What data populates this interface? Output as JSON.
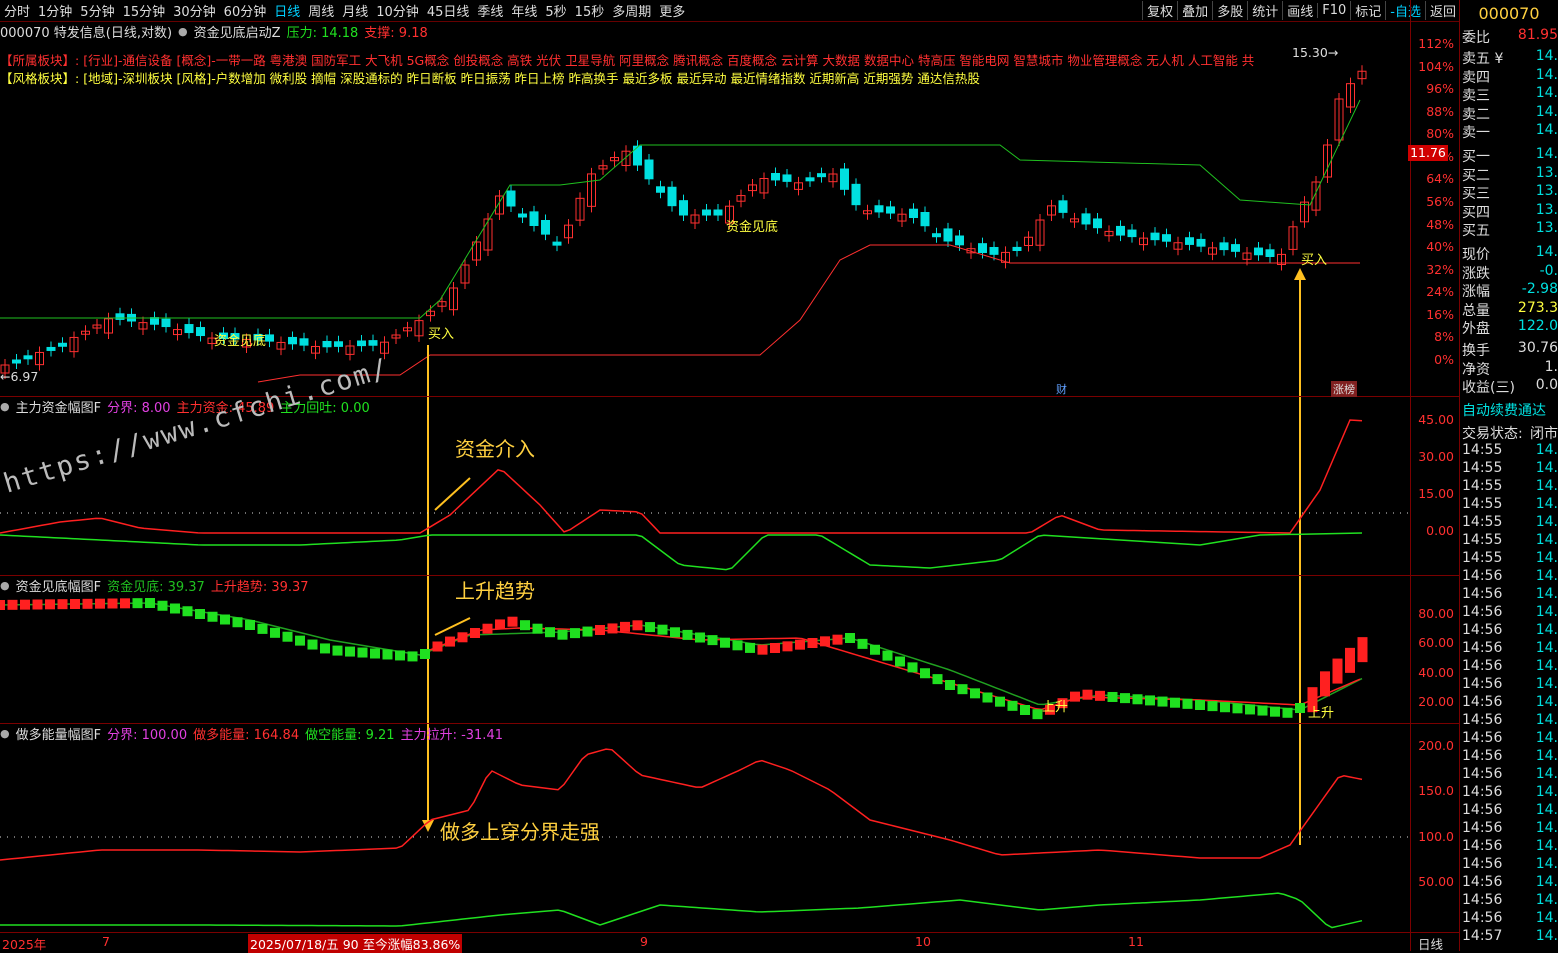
{
  "toolbar": {
    "periods": [
      "分时",
      "1分钟",
      "5分钟",
      "15分钟",
      "30分钟",
      "60分钟",
      "日线",
      "周线",
      "月线",
      "10分钟",
      "45日线",
      "季线",
      "年线",
      "5秒",
      "15秒",
      "多周期",
      "更多"
    ],
    "active": "日线",
    "tools": [
      "复权",
      "叠加",
      "多股",
      "统计",
      "画线",
      "F10",
      "标记",
      "-自选",
      "返回"
    ]
  },
  "main": {
    "title": "000070 特发信息(日线,对数)",
    "indicator": "资金见底启动Z",
    "pressure": "压力: 14.18",
    "support": "支撑: 9.18",
    "industry_label": "【所属板块】:",
    "industry_text": "[行业]-通信设备 [概念]-一带一路 粤港澳 国防军工 大飞机 5G概念 创投概念 高铁 光伏 卫星导航 阿里概念 腾讯概念 百度概念 云计算 大数据 数据中心 特高压 智能电网 智慧城市 物业管理概念 无人机 人工智能 共",
    "style_label": "【风格板块】:",
    "style_text": "[地域]-深圳板块 [风格]-户数增加 微利股 摘帽 深股通标的 昨日断板 昨日振荡 昨日上榜 昨高换手 最近多板 最近异动 最近情绪指数 近期新高 近期强势 通达信热股",
    "low_label": "6.97",
    "high_label": "15.30",
    "price_tag": "11.76",
    "buy_label_1": "买入",
    "buy_label_2": "买入",
    "zjjd_1": "资金见底",
    "zjjd_2": "资金见底",
    "cai": "财",
    "zhangbang": "涨榜",
    "axis": [
      "112%",
      "104%",
      "96%",
      "88%",
      "80%",
      "72%",
      "64%",
      "56%",
      "48%",
      "40%",
      "32%",
      "24%",
      "16%",
      "8%",
      "0%"
    ]
  },
  "panel1": {
    "name": "主力资金幅图F",
    "divide": "分界: 8.00",
    "main_fund": "主力资金: 45.89",
    "pullback": "主力回吐: 0.00",
    "axis": [
      "45.00",
      "30.00",
      "15.00",
      "0.00"
    ],
    "annotation": "资金介入"
  },
  "panel2": {
    "name": "资金见底幅图F",
    "bottom": "资金见底: 39.37",
    "trend": "上升趋势: 39.37",
    "axis": [
      "80.00",
      "60.00",
      "40.00",
      "20.00"
    ],
    "annotation": "上升趋势",
    "up1": "上升",
    "up2": "上升"
  },
  "panel3": {
    "name": "做多能量幅图F",
    "divide": "分界: 100.00",
    "long_energy": "做多能量: 164.84",
    "short_energy": "做空能量: 9.21",
    "pull": "主力拉升: -31.41",
    "axis": [
      "200.0",
      "150.0",
      "100.0",
      "50.00"
    ],
    "annotation": "做多上穿分界走强"
  },
  "watermark": "https://www.cfchi.com/",
  "bottom_axis": {
    "year": "2025年",
    "m7": "7",
    "date_box": "2025/07/18/五 90 至今涨幅83.86%",
    "m9": "9",
    "m10": "10",
    "m11": "11",
    "period": "日线"
  },
  "right_panel": {
    "code": "000070",
    "weibi": [
      "委比",
      "81.95"
    ],
    "sell": [
      [
        "卖五 ¥",
        "14."
      ],
      [
        "卖四",
        "14."
      ],
      [
        "卖三",
        "14."
      ],
      [
        "卖二",
        "14."
      ],
      [
        "卖一",
        "14."
      ]
    ],
    "buy": [
      [
        "买一",
        "14."
      ],
      [
        "买二",
        "13."
      ],
      [
        "买三",
        "13."
      ],
      [
        "买四",
        "13."
      ],
      [
        "买五",
        "13."
      ]
    ],
    "stats": [
      [
        "现价",
        "14."
      ],
      [
        "涨跌",
        "-0."
      ],
      [
        "涨幅",
        "-2.98"
      ],
      [
        "总量",
        "273.3"
      ],
      [
        "外盘",
        "122.0"
      ]
    ],
    "stats2": [
      [
        "换手",
        "30.76"
      ],
      [
        "净资",
        "1."
      ],
      [
        "收益(三)",
        "0.0"
      ]
    ],
    "auto_fee": "自动续费通达",
    "trade_state_label": "交易状态:",
    "trade_state": "闭市",
    "ticks": [
      [
        "14:55",
        "14."
      ],
      [
        "14:55",
        "14."
      ],
      [
        "14:55",
        "14."
      ],
      [
        "14:55",
        "14."
      ],
      [
        "14:55",
        "14."
      ],
      [
        "14:55",
        "14."
      ],
      [
        "14:55",
        "14."
      ],
      [
        "14:56",
        "14."
      ],
      [
        "14:56",
        "14."
      ],
      [
        "14:56",
        "14."
      ],
      [
        "14:56",
        "14."
      ],
      [
        "14:56",
        "14."
      ],
      [
        "14:56",
        "14."
      ],
      [
        "14:56",
        "14."
      ],
      [
        "14:56",
        "14."
      ],
      [
        "14:56",
        "14."
      ],
      [
        "14:56",
        "14."
      ],
      [
        "14:56",
        "14."
      ],
      [
        "14:56",
        "14."
      ],
      [
        "14:56",
        "14."
      ],
      [
        "14:56",
        "14."
      ],
      [
        "14:56",
        "14."
      ],
      [
        "14:56",
        "14."
      ],
      [
        "14:56",
        "14."
      ],
      [
        "14:56",
        "14."
      ],
      [
        "14:56",
        "14."
      ],
      [
        "14:56",
        "14."
      ],
      [
        "14:57",
        "14."
      ]
    ]
  },
  "colors": {
    "up": "#ff3030",
    "down": "#00e0e0",
    "line_green": "#20e020",
    "line_red": "#ff2020",
    "annot": "#ffc020"
  }
}
